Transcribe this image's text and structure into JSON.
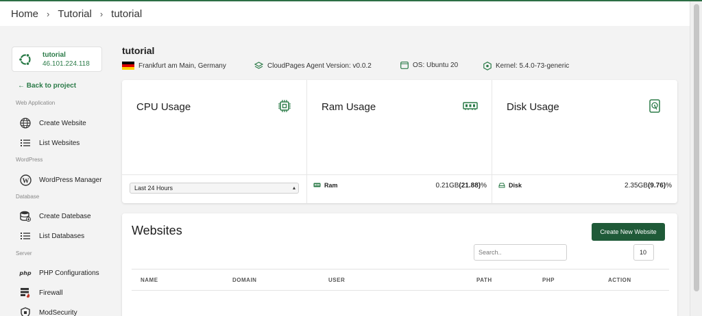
{
  "breadcrumb": {
    "items": [
      "Home",
      "Tutorial",
      "tutorial"
    ],
    "separator": "›"
  },
  "server_card": {
    "name": "tutorial",
    "ip": "46.101.224.118",
    "logo_icon": "ubuntu-icon"
  },
  "sidebar": {
    "back_link": "← Back to project",
    "sections": [
      {
        "label": "Web Application",
        "items": [
          {
            "label": "Create Website",
            "icon": "globe-icon"
          },
          {
            "label": "List Websites",
            "icon": "list-icon"
          }
        ]
      },
      {
        "label": "WordPress",
        "items": [
          {
            "label": "WordPress Manager",
            "icon": "wordpress-icon"
          }
        ]
      },
      {
        "label": "Database",
        "items": [
          {
            "label": "Create Datebase",
            "icon": "database-add-icon"
          },
          {
            "label": "List Databases",
            "icon": "list-icon"
          }
        ]
      },
      {
        "label": "Server",
        "items": [
          {
            "label": "PHP Configurations",
            "icon": "php-icon"
          },
          {
            "label": "Firewall",
            "icon": "firewall-icon"
          },
          {
            "label": "ModSecurity",
            "icon": "modsecurity-icon"
          }
        ]
      }
    ]
  },
  "server": {
    "title": "tutorial",
    "location": "Frankfurt am Main, Germany",
    "agent_version": "CloudPages Agent Version: v0.0.2",
    "os": "OS: Ubuntu 20",
    "kernel": "Kernel: 5.4.0-73-generic"
  },
  "usage": {
    "cpu": {
      "title": "CPU Usage",
      "icon": "cpu-icon",
      "range_select": "Last 24 Hours"
    },
    "ram": {
      "title": "Ram Usage",
      "icon": "ram-icon",
      "label": "Ram",
      "value": "0.21GB",
      "percent": "(21.88)",
      "percent_sign": "%"
    },
    "disk": {
      "title": "Disk Usage",
      "icon": "disk-icon",
      "label": "Disk",
      "value": "2.35GB",
      "percent": "(9.76)",
      "percent_sign": "%"
    }
  },
  "websites": {
    "title": "Websites",
    "create_button": "Create New Website",
    "search_placeholder": "Search..",
    "page_size": "10",
    "columns": [
      "NAME",
      "DOMAIN",
      "USER",
      "PATH",
      "PHP",
      "ACTION"
    ]
  },
  "colors": {
    "accent": "#2a7a47",
    "button": "#1f5a38",
    "background": "#f3f3f3"
  }
}
